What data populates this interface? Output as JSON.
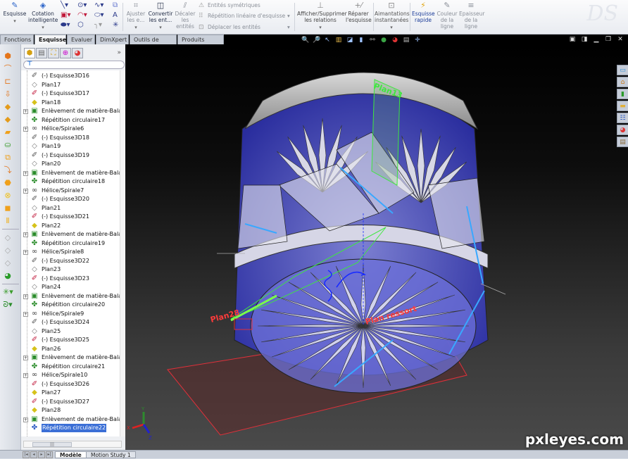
{
  "ribbon": {
    "esquisse": "Esquisse",
    "cotation": "Cotation intelligente",
    "ajuster": "Ajuster les e...",
    "convertir": "Convertir les ent...",
    "decaler": "Décaler les entités",
    "entites_sym": "Entités symétriques",
    "repetition_lin": "Répétition linéaire d'esquisse",
    "deplacer": "Déplacer les entités",
    "afficher_rel": "Afficher/Supprimer les relations",
    "reparer": "Réparer l'esquisse",
    "aimantations": "Aimantations instantanées",
    "esquisse_rapide": "Esquisse rapide",
    "couleur_ligne": "Couleur de la ligne",
    "epaisseur_ligne": "Epaisseur de la ligne",
    "logo": "DS"
  },
  "tabs": [
    "Fonctions",
    "Esquisse",
    "Evaluer",
    "DimXpert",
    "Outils de rendu",
    "Produits Office"
  ],
  "active_tab": "Esquisse",
  "tree": [
    {
      "label": "(-) Esquisse3D16",
      "type": "sketch3d",
      "exp": false
    },
    {
      "label": "Plan17",
      "type": "plane",
      "exp": false
    },
    {
      "label": "(-) Esquisse3D17",
      "type": "sketch3d-edit",
      "exp": false
    },
    {
      "label": "Plan18",
      "type": "plane-yellow",
      "exp": false
    },
    {
      "label": "Enlèvement de matière-Balay",
      "type": "cut",
      "exp": true
    },
    {
      "label": "Répétition circulaire17",
      "type": "pattern",
      "exp": false
    },
    {
      "label": "Hélice/Spirale6",
      "type": "helix",
      "exp": true
    },
    {
      "label": "(-) Esquisse3D18",
      "type": "sketch3d",
      "exp": false
    },
    {
      "label": "Plan19",
      "type": "plane",
      "exp": false
    },
    {
      "label": "(-) Esquisse3D19",
      "type": "sketch3d",
      "exp": false
    },
    {
      "label": "Plan20",
      "type": "plane",
      "exp": false
    },
    {
      "label": "Enlèvement de matière-Balay",
      "type": "cut",
      "exp": true
    },
    {
      "label": "Répétition circulaire18",
      "type": "pattern",
      "exp": false
    },
    {
      "label": "Hélice/Spirale7",
      "type": "helix",
      "exp": true
    },
    {
      "label": "(-) Esquisse3D20",
      "type": "sketch3d",
      "exp": false
    },
    {
      "label": "Plan21",
      "type": "plane",
      "exp": false
    },
    {
      "label": "(-) Esquisse3D21",
      "type": "sketch3d-edit",
      "exp": false
    },
    {
      "label": "Plan22",
      "type": "plane-yellow",
      "exp": false
    },
    {
      "label": "Enlèvement de matière-Balay",
      "type": "cut",
      "exp": true
    },
    {
      "label": "Répétition circulaire19",
      "type": "pattern",
      "exp": false
    },
    {
      "label": "Hélice/Spirale8",
      "type": "helix",
      "exp": true
    },
    {
      "label": "(-) Esquisse3D22",
      "type": "sketch3d",
      "exp": false
    },
    {
      "label": "Plan23",
      "type": "plane",
      "exp": false
    },
    {
      "label": "(-) Esquisse3D23",
      "type": "sketch3d-edit",
      "exp": false
    },
    {
      "label": "Plan24",
      "type": "plane",
      "exp": false
    },
    {
      "label": "Enlèvement de matière-Balay",
      "type": "cut",
      "exp": true
    },
    {
      "label": "Répétition circulaire20",
      "type": "pattern",
      "exp": false
    },
    {
      "label": "Hélice/Spirale9",
      "type": "helix",
      "exp": true
    },
    {
      "label": "(-) Esquisse3D24",
      "type": "sketch3d",
      "exp": false
    },
    {
      "label": "Plan25",
      "type": "plane",
      "exp": false
    },
    {
      "label": "(-) Esquisse3D25",
      "type": "sketch3d-edit",
      "exp": false
    },
    {
      "label": "Plan26",
      "type": "plane-yellow",
      "exp": false
    },
    {
      "label": "Enlèvement de matière-Balay",
      "type": "cut",
      "exp": true
    },
    {
      "label": "Répétition circulaire21",
      "type": "pattern",
      "exp": false
    },
    {
      "label": "Hélice/Spirale10",
      "type": "helix",
      "exp": true
    },
    {
      "label": "(-) Esquisse3D26",
      "type": "sketch3d-edit",
      "exp": false
    },
    {
      "label": "Plan27",
      "type": "plane-yellow",
      "exp": false
    },
    {
      "label": "(-) Esquisse3D27",
      "type": "sketch3d-edit",
      "exp": false
    },
    {
      "label": "Plan28",
      "type": "plane-yellow",
      "exp": false
    },
    {
      "label": "Enlèvement de matière-Balay",
      "type": "cut",
      "exp": true
    },
    {
      "label": "Répétition circulaire22",
      "type": "pattern-blue",
      "exp": false,
      "selected": true
    }
  ],
  "bottom_tabs": [
    "Modèle",
    "Motion Study 1"
  ],
  "active_bottom_tab": "Modèle",
  "viewport": {
    "labels": {
      "plan13": "Plan13",
      "plan28": "Plan28",
      "plan_ressort": "Plan ressort"
    },
    "axes": {
      "x": "X",
      "y": "Y",
      "z": "Z"
    },
    "colors": {
      "glass": "#4a4fd0",
      "plane_green": "#3ee83e",
      "plane_red": "#e0303a",
      "sketch_blue": "#1a2cff",
      "helix_cyan": "#39a8ff"
    }
  },
  "watermark": "pxleyes.com"
}
